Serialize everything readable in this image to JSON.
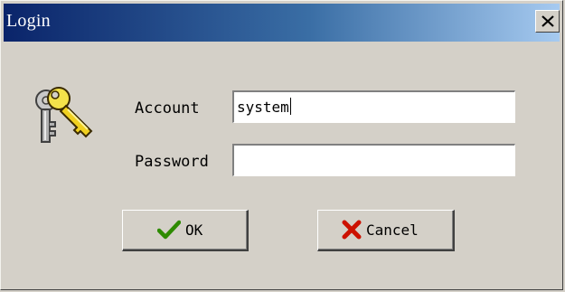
{
  "window": {
    "title": "Login"
  },
  "form": {
    "account_label": "Account",
    "account_value": "system",
    "password_label": "Password",
    "password_value": ""
  },
  "buttons": {
    "ok_label": "OK",
    "cancel_label": "Cancel"
  },
  "icons": {
    "close": "close-icon",
    "keys": "keys-icon",
    "ok": "checkmark-icon",
    "cancel": "cross-icon"
  },
  "colors": {
    "titlebar_start": "#0a246a",
    "titlebar_end": "#a6caf0",
    "ok_check": "#2e8b00",
    "cancel_x": "#cc1100"
  }
}
